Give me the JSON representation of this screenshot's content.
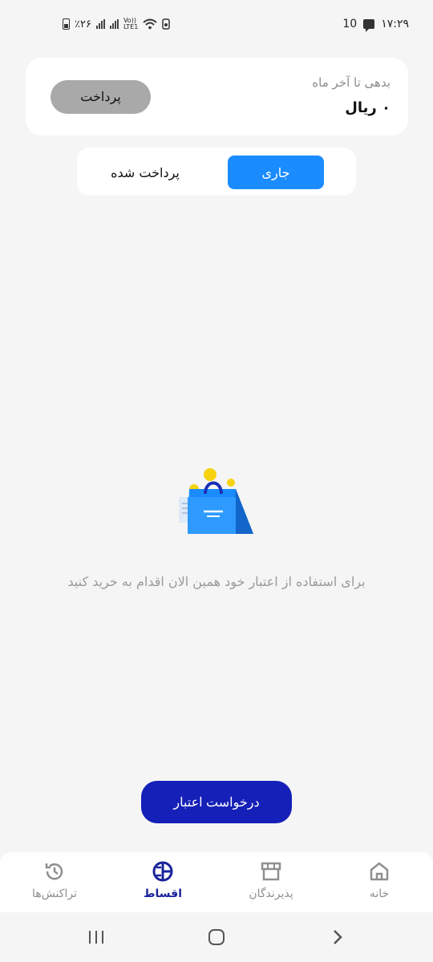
{
  "status_bar": {
    "time": "۱۷:۲۹",
    "notification_count": "10",
    "battery_text": "٪۲۶",
    "volte_label": "Vo))\nLTE1"
  },
  "debt_card": {
    "label": "بدهی تا آخر ماه",
    "value": "۰ ریال",
    "pay_label": "پرداخت"
  },
  "tabs": {
    "current_label": "جاری",
    "paid_label": "پرداخت شده",
    "active": "current"
  },
  "empty_state": {
    "illustration_icon": "shopping-bag-coins-icon",
    "message": "برای استفاده از اعتبار خود همین الان اقدام به خرید کنید"
  },
  "credit_request_label": "درخواست اعتبار",
  "bottom_nav": {
    "active": "installments",
    "items": [
      {
        "key": "home",
        "label": "خانه",
        "icon": "home-icon"
      },
      {
        "key": "merchants",
        "label": "پذیرندگان",
        "icon": "store-icon"
      },
      {
        "key": "installments",
        "label": "اقساط",
        "icon": "installments-icon"
      },
      {
        "key": "transactions",
        "label": "تراکنش‌ها",
        "icon": "history-icon"
      }
    ]
  },
  "colors": {
    "primary_blue": "#1a8cff",
    "dark_blue": "#1520b8",
    "nav_active": "#1a239a",
    "background": "#f5f5f5"
  }
}
